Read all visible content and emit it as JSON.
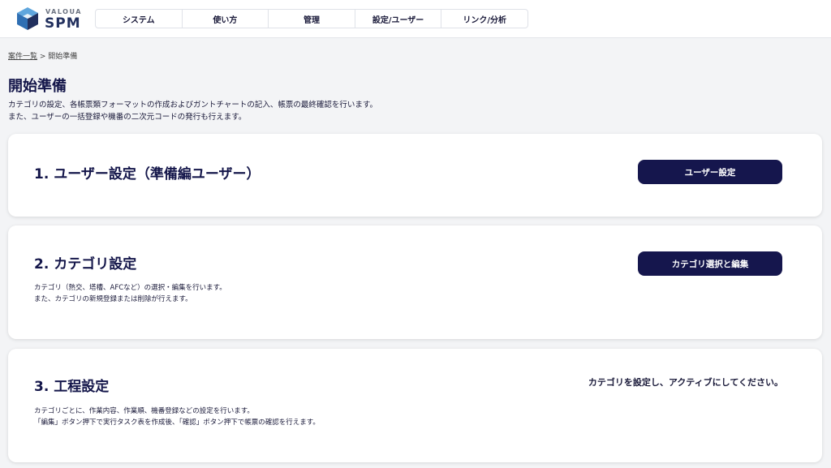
{
  "brand": {
    "small": "VALOUA",
    "big": "SPM"
  },
  "nav": {
    "items": [
      {
        "label": "システム"
      },
      {
        "label": "使い方"
      },
      {
        "label": "管理"
      },
      {
        "label": "設定/ユーザー"
      },
      {
        "label": "リンク/分析"
      }
    ]
  },
  "breadcrumb": {
    "link": "案件一覧",
    "separator": " > ",
    "current": "開始準備"
  },
  "page": {
    "title": "開始準備",
    "desc_line1": "カテゴリの設定、各帳票類フォーマットの作成およびガントチャートの記入、帳票の最終確認を行います。",
    "desc_line2": "また、ユーザーの一括登録や機番の二次元コードの発行も行えます。"
  },
  "sections": [
    {
      "title": "1. ユーザー設定（準備編ユーザー）",
      "button": "ユーザー設定"
    },
    {
      "title": "2. カテゴリ設定",
      "desc_line1": "カテゴリ（熱交、塔槽、AFCなど）の選択・編集を行います。",
      "desc_line2": "また、カテゴリの新規登録または削除が行えます。",
      "button": "カテゴリ選択と編集"
    },
    {
      "title": "3. 工程設定",
      "desc_line1": "カテゴリごとに、作業内容、作業順、機番登録などの設定を行います。",
      "desc_line2": "「編集」ボタン押下で実行タスク表を作成後、「確認」ボタン押下で帳票の確認を行えます。",
      "note": "カテゴリを設定し、アクティブにしてください。"
    }
  ],
  "colors": {
    "accent": "#15164d",
    "logo_blue": "#2f6fb3",
    "logo_light": "#5fa6dd"
  }
}
